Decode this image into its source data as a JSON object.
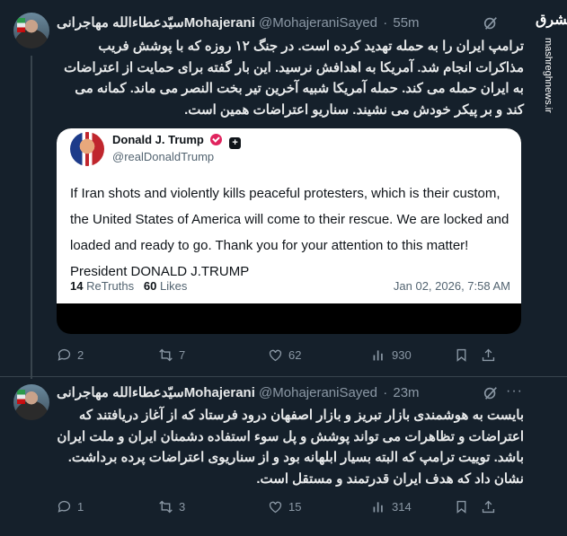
{
  "brand": {
    "logo_text": "مشرق",
    "url": "mashreghnews.ir"
  },
  "tweets": [
    {
      "name": "سیّدعطاءالله مهاجرانیMohajerani",
      "handle": "@MohajeraniSayed",
      "time": "55m",
      "text": "ترامپ ایران را به حمله تهدید کرده است. در جنگ ۱۲ روزه که با پوشش فریب مذاکرات انجام شد. آمریکا به اهدافش نرسید. این بار گفته برای حمایت از اعتراضات به ایران حمله می کند. حمله آمریکا شبیه آخرین تیر بخت النصر می ماند. کمانه می کند و بر پیکر خودش می نشیند. سناریو اعتراضات همین است.",
      "quote": {
        "name": "Donald J. Trump",
        "handle": "@realDonaldTrump",
        "text": "If Iran shots and violently kills peaceful protesters, which is their custom, the United States of America will come to their rescue. We are locked and loaded and ready to go. Thank you for your attention to this matter! President DONALD J.TRUMP",
        "retruths_count": "14",
        "retruths_label": "ReTruths",
        "likes_count": "60",
        "likes_label": "Likes",
        "date": "Jan 02, 2026, 7:58 AM"
      },
      "stats": {
        "replies": "2",
        "reposts": "7",
        "likes": "62",
        "views": "930"
      }
    },
    {
      "name": "سیّدعطاءالله مهاجرانیMohajerani",
      "handle": "@MohajeraniSayed",
      "time": "23m",
      "text": "بایست به هوشمندی بازار تبریز و بازار اصفهان درود فرستاد که از آغاز دریافتند که اعتراضات و تظاهرات می تواند پوشش و پل سوء استفاده دشمنان ایران و ملت ایران باشد. توییت ترامپ که البته بسیار ابلهانه بود و از سناریوی اعتراضات پرده برداشت. نشان داد که هدف ایران قدرتمند و مستقل است.",
      "stats": {
        "replies": "1",
        "reposts": "3",
        "likes": "15",
        "views": "314"
      }
    }
  ]
}
